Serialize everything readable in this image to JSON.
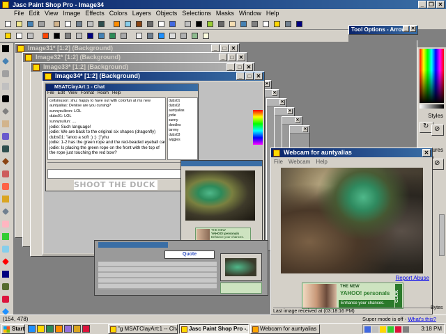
{
  "app": {
    "title": "Jasc Paint Shop Pro - Image34"
  },
  "menu": [
    "File",
    "Edit",
    "View",
    "Image",
    "Effects",
    "Colors",
    "Layers",
    "Objects",
    "Selections",
    "Masks",
    "Window",
    "Help"
  ],
  "tool_options": {
    "title": "Tool Options - Arrow"
  },
  "image_windows": [
    {
      "title": "Image31* [1:2] (Background)"
    },
    {
      "title": "Image32* [1:2] (Background)"
    },
    {
      "title": "Image33* [1:2] (Background)"
    },
    {
      "title": "Image34* [1:2] (Background)"
    }
  ],
  "chat": {
    "title": "MSATClayArt:1 - Chat",
    "menu": [
      "File",
      "Edit",
      "View",
      "Format",
      "Room",
      "Help"
    ],
    "messages": [
      "cellsinuson: shu: happy to have out with colorfun at ms new",
      "auntyalias: Deniise are you cursing?",
      "sunnysulleon: LOL",
      "dubs01: LOL",
      "sunnysullun: ....",
      "jodie: Such language!",
      "jodie: We are back to the original six shapes (dragonfly)",
      "dubs01: \"anoo a soft :) :) :)\"yhu",
      "jodie: 1-2 has the green rope and the red-beaded eyeball cane",
      "jodie: Is placing the green rope on the front with the top of",
      "the rope just touching the red bow?"
    ],
    "members": [
      "dubs01",
      "dubs02",
      "auntyalias",
      "jodie",
      "sunny",
      "doodles",
      "tarrmy",
      "dubs03",
      "wiggles"
    ],
    "banner": "SHOOT THE DUCK",
    "quote": "Quote"
  },
  "webcam": {
    "title": "Webcam for auntyalias",
    "menu": [
      "File",
      "Webcam",
      "Help"
    ],
    "report_abuse": "Report Abuse",
    "ad_the_new": "THE NEW",
    "ad_brand": "YAHOO! personals",
    "ad_tagline": "Enhance your chances.",
    "ad_click": "CLICK",
    "status": "Last image received at (03:18:16 PM)"
  },
  "inner_webcam": {
    "ad_the_new": "THE NEW",
    "ad_brand": "YAHOO! personals",
    "ad_tagline": "Enhance your chances."
  },
  "right_panels": {
    "styles": "Styles",
    "textures": "Textures"
  },
  "status_bar": {
    "coords": "(154, 478)",
    "super_mode": "Super mode is off",
    "whats_this": "What's this?",
    "bytes": "Bytes"
  },
  "taskbar": {
    "start": "Start",
    "tasks": [
      {
        "label": "\"g MSATClayArt:1 -- Chat",
        "active": false
      },
      {
        "label": "Jasc Paint Shop Pro -...",
        "active": true
      },
      {
        "label": "Webcam for auntyalias",
        "active": false
      }
    ],
    "clock": "3:18 PM"
  },
  "colors": {
    "title_active": "#0a246a",
    "title_inactive": "#808080",
    "face": "#d4d0c8",
    "desktop": "#808080",
    "yahoo_green": "#2b7a2b"
  }
}
